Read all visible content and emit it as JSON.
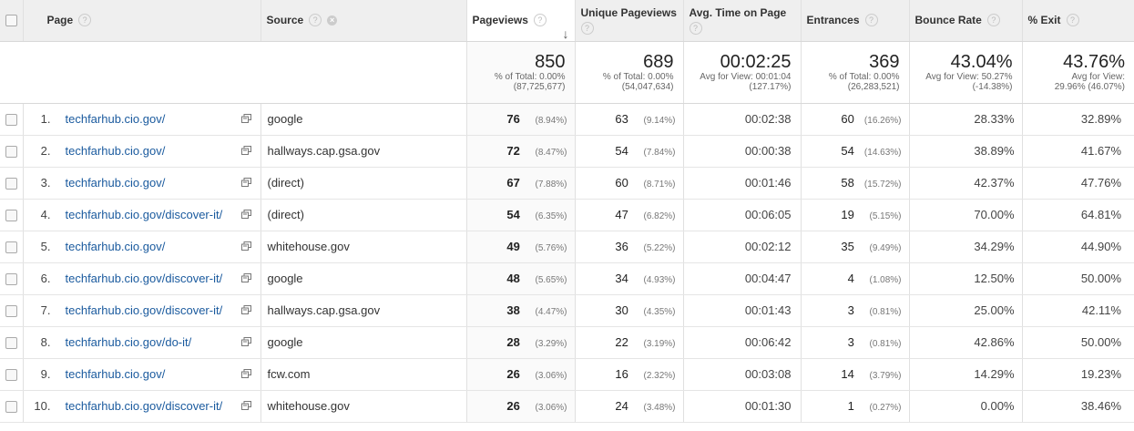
{
  "headers": {
    "page": "Page",
    "source": "Source",
    "pageviews": "Pageviews",
    "unique_pageviews": "Unique Pageviews",
    "avg_time": "Avg. Time on Page",
    "entrances": "Entrances",
    "bounce_rate": "Bounce Rate",
    "exit": "% Exit"
  },
  "totals": {
    "pageviews": {
      "value": "850",
      "line1": "% of Total: 0.00%",
      "line2": "(87,725,677)"
    },
    "unique_pageviews": {
      "value": "689",
      "line1": "% of Total: 0.00%",
      "line2": "(54,047,634)"
    },
    "avg_time": {
      "value": "00:02:25",
      "line1": "Avg for View: 00:01:04",
      "line2": "(127.17%)"
    },
    "entrances": {
      "value": "369",
      "line1": "% of Total: 0.00%",
      "line2": "(26,283,521)"
    },
    "bounce_rate": {
      "value": "43.04%",
      "line1": "Avg for View: 50.27%",
      "line2": "(-14.38%)"
    },
    "exit": {
      "value": "43.76%",
      "line1": "Avg for View:",
      "line2": "29.96% (46.07%)"
    }
  },
  "rows": [
    {
      "n": "1.",
      "page": "techfarhub.cio.gov/",
      "source": "google",
      "pv": "76",
      "pv_pct": "(8.94%)",
      "upv": "63",
      "upv_pct": "(9.14%)",
      "time": "00:02:38",
      "ent": "60",
      "ent_pct": "(16.26%)",
      "bounce": "28.33%",
      "exit": "32.89%"
    },
    {
      "n": "2.",
      "page": "techfarhub.cio.gov/",
      "source": "hallways.cap.gsa.gov",
      "pv": "72",
      "pv_pct": "(8.47%)",
      "upv": "54",
      "upv_pct": "(7.84%)",
      "time": "00:00:38",
      "ent": "54",
      "ent_pct": "(14.63%)",
      "bounce": "38.89%",
      "exit": "41.67%"
    },
    {
      "n": "3.",
      "page": "techfarhub.cio.gov/",
      "source": "(direct)",
      "pv": "67",
      "pv_pct": "(7.88%)",
      "upv": "60",
      "upv_pct": "(8.71%)",
      "time": "00:01:46",
      "ent": "58",
      "ent_pct": "(15.72%)",
      "bounce": "42.37%",
      "exit": "47.76%"
    },
    {
      "n": "4.",
      "page": "techfarhub.cio.gov/discover-it/",
      "source": "(direct)",
      "pv": "54",
      "pv_pct": "(6.35%)",
      "upv": "47",
      "upv_pct": "(6.82%)",
      "time": "00:06:05",
      "ent": "19",
      "ent_pct": "(5.15%)",
      "bounce": "70.00%",
      "exit": "64.81%"
    },
    {
      "n": "5.",
      "page": "techfarhub.cio.gov/",
      "source": "whitehouse.gov",
      "pv": "49",
      "pv_pct": "(5.76%)",
      "upv": "36",
      "upv_pct": "(5.22%)",
      "time": "00:02:12",
      "ent": "35",
      "ent_pct": "(9.49%)",
      "bounce": "34.29%",
      "exit": "44.90%"
    },
    {
      "n": "6.",
      "page": "techfarhub.cio.gov/discover-it/",
      "source": "google",
      "pv": "48",
      "pv_pct": "(5.65%)",
      "upv": "34",
      "upv_pct": "(4.93%)",
      "time": "00:04:47",
      "ent": "4",
      "ent_pct": "(1.08%)",
      "bounce": "12.50%",
      "exit": "50.00%"
    },
    {
      "n": "7.",
      "page": "techfarhub.cio.gov/discover-it/",
      "source": "hallways.cap.gsa.gov",
      "pv": "38",
      "pv_pct": "(4.47%)",
      "upv": "30",
      "upv_pct": "(4.35%)",
      "time": "00:01:43",
      "ent": "3",
      "ent_pct": "(0.81%)",
      "bounce": "25.00%",
      "exit": "42.11%"
    },
    {
      "n": "8.",
      "page": "techfarhub.cio.gov/do-it/",
      "source": "google",
      "pv": "28",
      "pv_pct": "(3.29%)",
      "upv": "22",
      "upv_pct": "(3.19%)",
      "time": "00:06:42",
      "ent": "3",
      "ent_pct": "(0.81%)",
      "bounce": "42.86%",
      "exit": "50.00%"
    },
    {
      "n": "9.",
      "page": "techfarhub.cio.gov/",
      "source": "fcw.com",
      "pv": "26",
      "pv_pct": "(3.06%)",
      "upv": "16",
      "upv_pct": "(2.32%)",
      "time": "00:03:08",
      "ent": "14",
      "ent_pct": "(3.79%)",
      "bounce": "14.29%",
      "exit": "19.23%"
    },
    {
      "n": "10.",
      "page": "techfarhub.cio.gov/discover-it/",
      "source": "whitehouse.gov",
      "pv": "26",
      "pv_pct": "(3.06%)",
      "upv": "24",
      "upv_pct": "(3.48%)",
      "time": "00:01:30",
      "ent": "1",
      "ent_pct": "(0.27%)",
      "bounce": "0.00%",
      "exit": "38.46%"
    }
  ]
}
